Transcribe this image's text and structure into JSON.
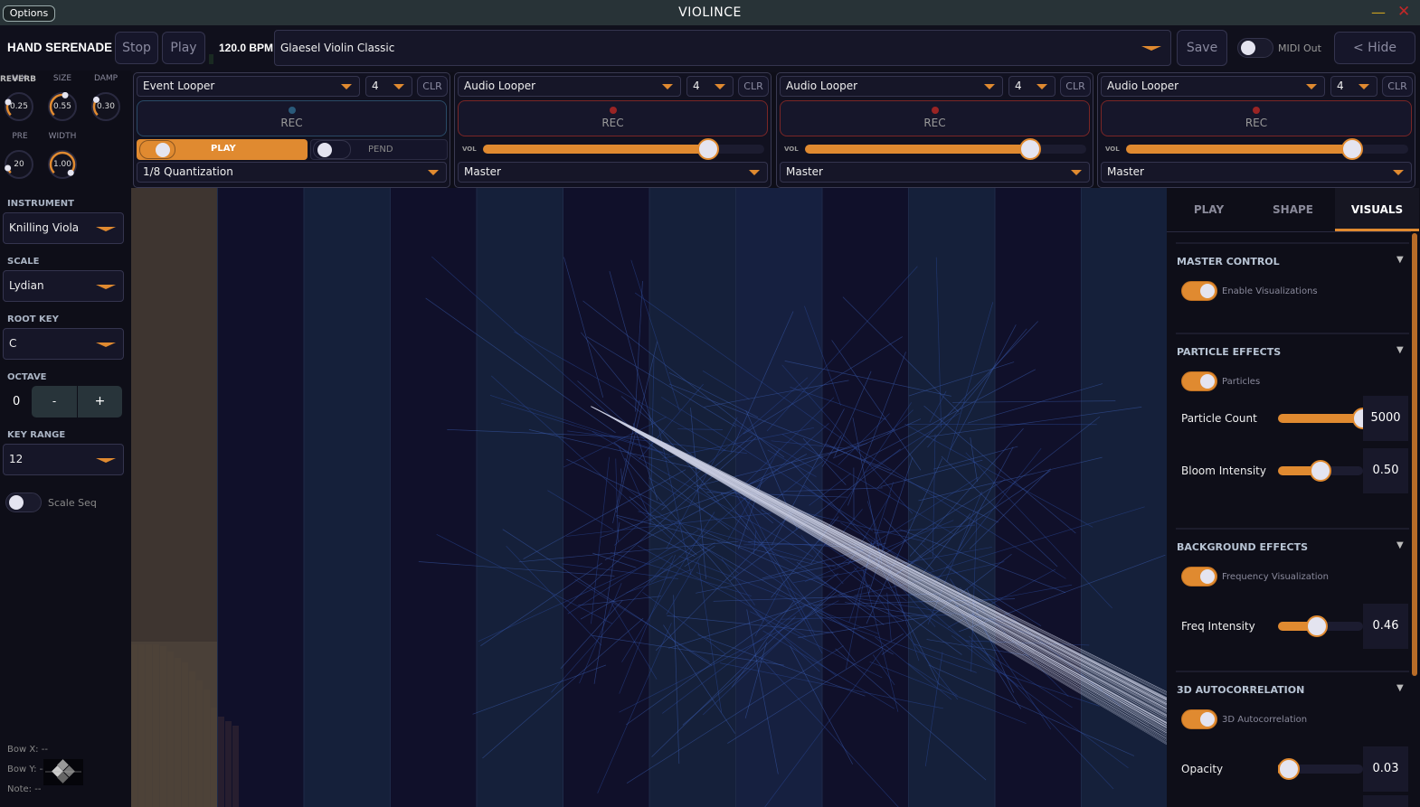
{
  "window": {
    "options_label": "Options",
    "title": "VIOLINCE",
    "minimize": "—",
    "close": "✕"
  },
  "topbar": {
    "brand": "HAND SERENADE",
    "stop": "Stop",
    "play": "Play",
    "bpm": "120.0 BPM",
    "preset": "Glaesel Violin Classic",
    "save": "Save",
    "midi_out": "MIDI Out",
    "midi_out_on": false,
    "hide": "< Hide"
  },
  "reverb": {
    "title": "REVERB",
    "knobs": [
      {
        "label": "MIX",
        "value": "0.25",
        "level": 0.25
      },
      {
        "label": "SIZE",
        "value": "0.55",
        "level": 0.55
      },
      {
        "label": "DAMP",
        "value": "0.30",
        "level": 0.3
      },
      {
        "label": "PRE",
        "value": "20",
        "level": 0.1
      },
      {
        "label": "WIDTH",
        "value": "1.00",
        "level": 1.0
      }
    ]
  },
  "loopers": [
    {
      "type": "Event Looper",
      "count": "4",
      "clr": "CLR",
      "rec": "REC",
      "play": "PLAY",
      "play_on": true,
      "pend": "PEND",
      "pend_on": false,
      "route": "1/8 Quantization"
    },
    {
      "type": "Audio Looper",
      "count": "4",
      "clr": "CLR",
      "rec": "REC",
      "vol_label": "VOL",
      "vol": 0.8,
      "route": "Master"
    },
    {
      "type": "Audio Looper",
      "count": "4",
      "clr": "CLR",
      "rec": "REC",
      "vol_label": "VOL",
      "vol": 0.8,
      "route": "Master"
    },
    {
      "type": "Audio Looper",
      "count": "4",
      "clr": "CLR",
      "rec": "REC",
      "vol_label": "VOL",
      "vol": 0.8,
      "route": "Master"
    }
  ],
  "left": {
    "instrument_label": "INSTRUMENT",
    "instrument": "Knilling Viola",
    "scale_label": "SCALE",
    "scale": "Lydian",
    "root_label": "ROOT KEY",
    "root": "C",
    "octave_label": "OCTAVE",
    "octave": "0",
    "minus": "-",
    "plus": "+",
    "range_label": "KEY RANGE",
    "range": "12",
    "scale_seq": "Scale Seq",
    "scale_seq_on": false,
    "bow_x": "Bow X: --",
    "bow_y": "Bow Y: --",
    "note": "Note: --"
  },
  "right": {
    "tabs": [
      "PLAY",
      "SHAPE",
      "VISUALS"
    ],
    "active_tab": "VISUALS",
    "sections": [
      {
        "title": "MASTER CONTROL",
        "toggle": "Enable Visualizations"
      },
      {
        "title": "PARTICLE EFFECTS",
        "toggle": "Particles",
        "sliders": [
          {
            "label": "Particle Count",
            "value": "5000",
            "level": 1.0
          },
          {
            "label": "Bloom Intensity",
            "value": "0.50",
            "level": 0.5
          }
        ]
      },
      {
        "title": "BACKGROUND EFFECTS",
        "toggle": "Frequency Visualization",
        "sliders": [
          {
            "label": "Freq Intensity",
            "value": "0.46",
            "level": 0.46
          }
        ]
      },
      {
        "title": "3D AUTOCORRELATION",
        "toggle": "3D Autocorrelation",
        "sliders": [
          {
            "label": "Opacity",
            "value": "0.03",
            "level": 0.03
          }
        ]
      }
    ]
  },
  "colors": {
    "accent": "#e08a30",
    "rec_red": "#9a2424",
    "event_blue": "#2a5a7a",
    "bg": "#0e0e18"
  }
}
